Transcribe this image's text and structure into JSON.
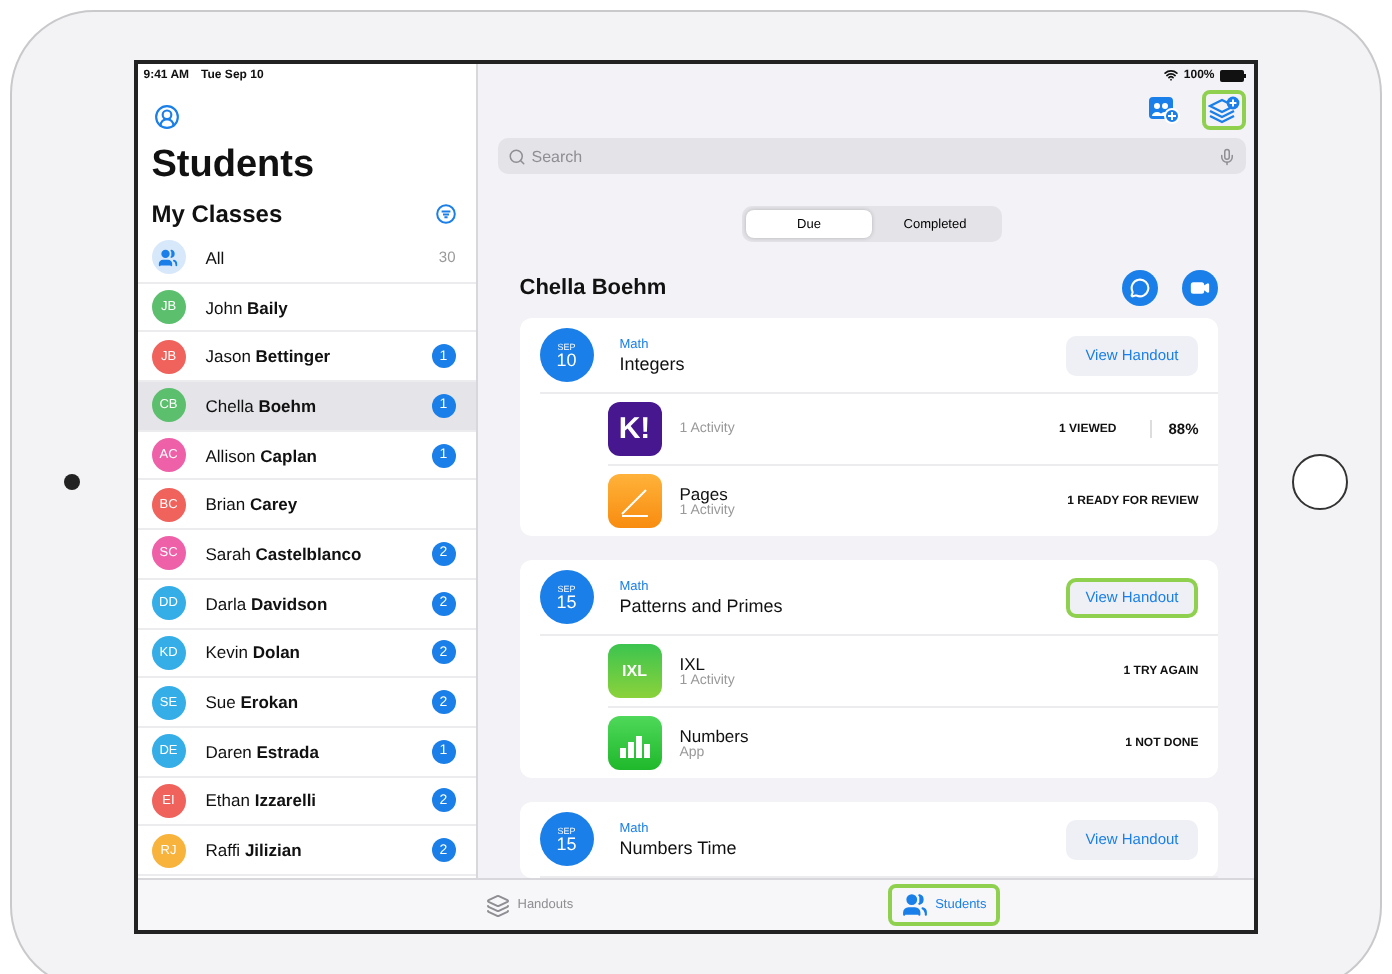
{
  "status_bar": {
    "time": "9:41 AM",
    "date": "Tue Sep 10",
    "battery": "100%"
  },
  "sidebar": {
    "title": "Students",
    "section": "My Classes",
    "items": [
      {
        "kind": "all",
        "name": "All",
        "count": "30",
        "selected": false
      },
      {
        "kind": "student",
        "initials": "JB",
        "name": "John **Baily**",
        "color": "#5cbf6e",
        "selected": false
      },
      {
        "kind": "student",
        "initials": "JB",
        "name": "Jason **Bettinger**",
        "color": "#f0625c",
        "badge": "1",
        "selected": false
      },
      {
        "kind": "student",
        "initials": "CB",
        "name": "Chella **Boehm**",
        "color": "#5cbf6e",
        "badge": "1",
        "selected": true
      },
      {
        "kind": "student",
        "initials": "AC",
        "name": "Allison **Caplan**",
        "color": "#ee61a8",
        "badge": "1",
        "selected": false
      },
      {
        "kind": "student",
        "initials": "BC",
        "name": "Brian **Carey**",
        "color": "#f0625c",
        "selected": false
      },
      {
        "kind": "student",
        "initials": "SC",
        "name": "Sarah **Castelblanco**",
        "color": "#ee61a8",
        "badge": "2",
        "selected": false
      },
      {
        "kind": "student",
        "initials": "DD",
        "name": "Darla **Davidson**",
        "color": "#35aee8",
        "badge": "2",
        "selected": false
      },
      {
        "kind": "student",
        "initials": "KD",
        "name": "Kevin **Dolan**",
        "color": "#35aee8",
        "badge": "2",
        "selected": false
      },
      {
        "kind": "student",
        "initials": "SE",
        "name": "Sue **Erokan**",
        "color": "#35aee8",
        "badge": "2",
        "selected": false
      },
      {
        "kind": "student",
        "initials": "DE",
        "name": "Daren **Estrada**",
        "color": "#35aee8",
        "badge": "1",
        "selected": false
      },
      {
        "kind": "student",
        "initials": "EI",
        "name": "Ethan **Izzarelli**",
        "color": "#f0625c",
        "badge": "2",
        "selected": false
      },
      {
        "kind": "student",
        "initials": "RJ",
        "name": "Raffi **Jilizian**",
        "color": "#f8b33c",
        "badge": "2",
        "selected": false
      }
    ]
  },
  "toolbar": [
    {
      "kind": "add-students",
      "highlighted": false
    },
    {
      "kind": "add-handout",
      "highlighted": true
    }
  ],
  "search": {
    "placeholder": "Search"
  },
  "segments": [
    {
      "label": "Due",
      "selected": true
    },
    {
      "label": "Completed",
      "selected": false
    }
  ],
  "student_name": "Chella Boehm",
  "handouts": [
    {
      "month": "SEP",
      "day": "10",
      "subject": "Math",
      "title": "Integers",
      "button": "View Handout",
      "highlighted": false,
      "activities": [
        {
          "kind": "kahoot",
          "logo_text": "K!",
          "sub": "1 Activity",
          "status": "1 VIEWED",
          "score": "88%"
        },
        {
          "kind": "pages",
          "name": "Pages",
          "sub": "1 Activity",
          "status": "1 READY FOR REVIEW"
        }
      ]
    },
    {
      "month": "SEP",
      "day": "15",
      "subject": "Math",
      "title": "Patterns and Primes",
      "button": "View Handout",
      "highlighted": true,
      "activities": [
        {
          "kind": "ixl",
          "logo_text": "IXL",
          "name": "IXL",
          "sub": "1 Activity",
          "status": "1 TRY AGAIN"
        },
        {
          "kind": "numbers",
          "name": "Numbers",
          "sub": "App",
          "status": "1 NOT DONE"
        }
      ]
    },
    {
      "month": "SEP",
      "day": "15",
      "subject": "Math",
      "title": "Numbers Time",
      "button": "View Handout",
      "highlighted": false
    }
  ],
  "tab_bar": [
    {
      "kind": "handouts",
      "label": "Handouts",
      "selected": false,
      "highlighted": false
    },
    {
      "kind": "students",
      "label": "Students",
      "selected": true,
      "highlighted": true
    }
  ]
}
